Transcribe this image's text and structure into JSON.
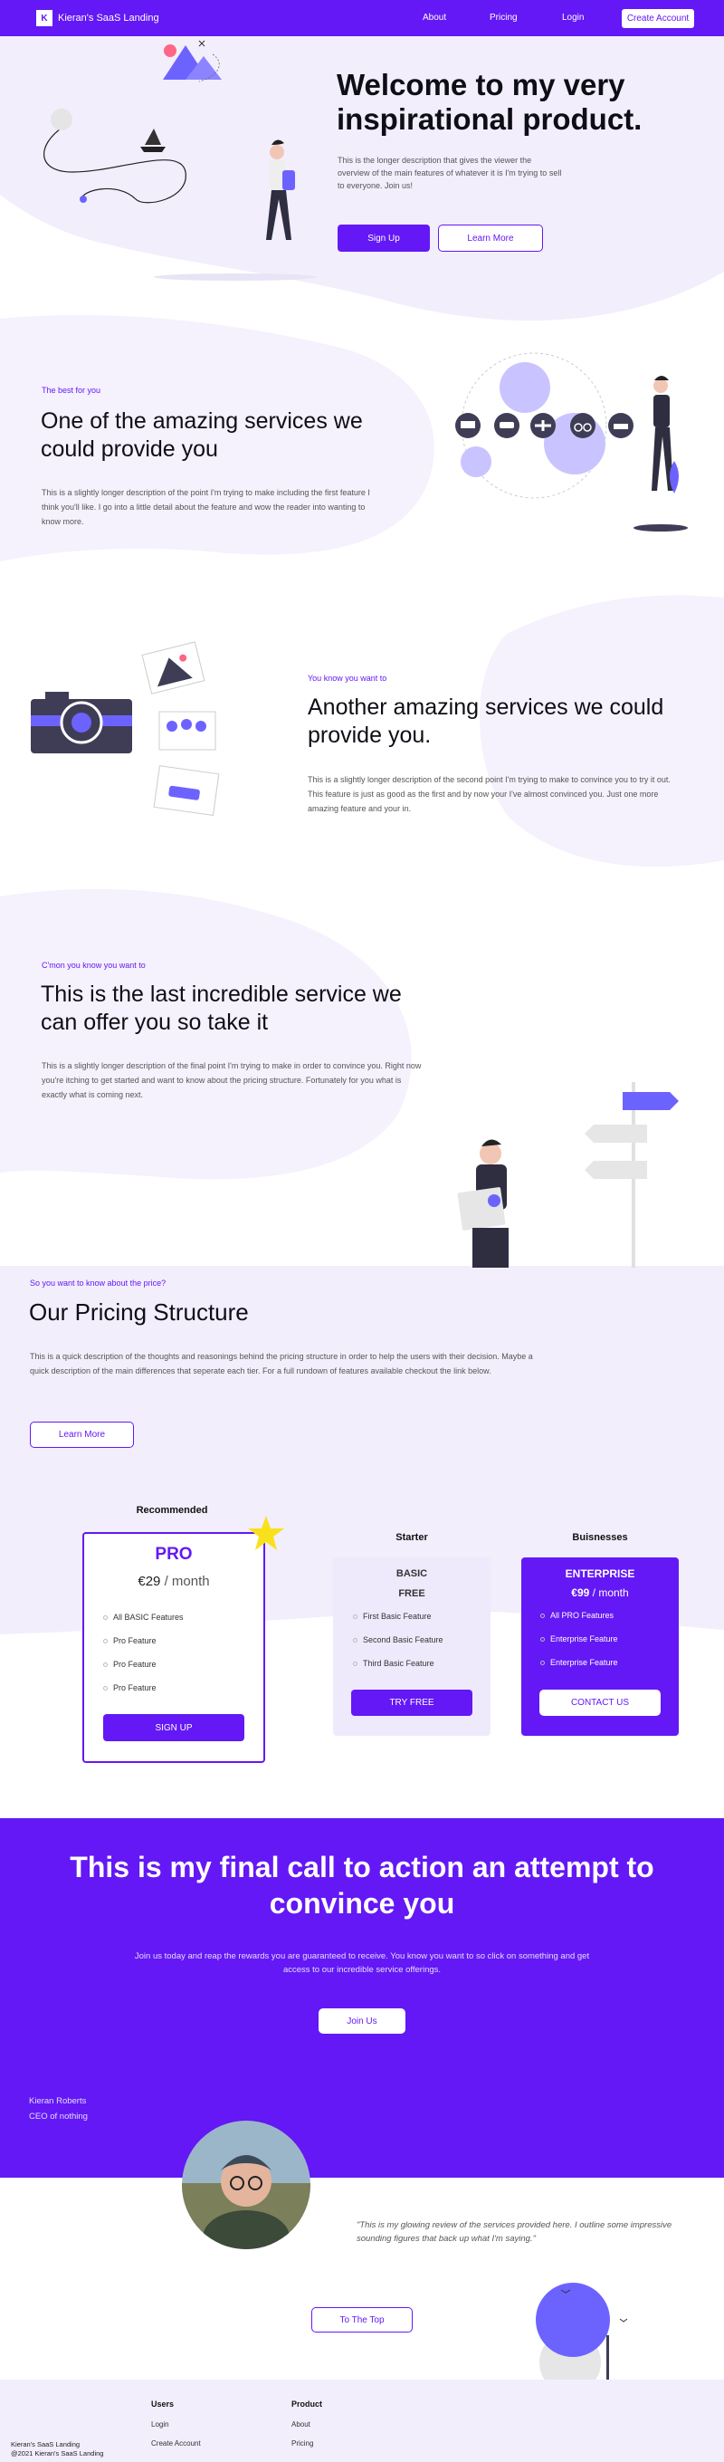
{
  "nav": {
    "brand": "Kieran's SaaS Landing",
    "links": [
      "About",
      "Pricing",
      "Login"
    ],
    "cta": "Create Account"
  },
  "hero": {
    "title": "Welcome to my very inspirational product.",
    "description": "This is the longer description that gives the viewer the overview of the main features of whatever it is I'm trying to sell to everyone. Join us!",
    "primary_button": "Sign Up",
    "secondary_button": "Learn More"
  },
  "feature1": {
    "eyebrow": "The best for you",
    "title": "One of the amazing services we could provide you",
    "description": "This is a slightly longer description of the point I'm trying to make including the first feature I think you'll like. I go into a little detail about the feature and wow the reader into wanting to know more."
  },
  "feature2": {
    "eyebrow": "You know you want to",
    "title": "Another amazing services we could provide you.",
    "description": "This is a slightly longer description of the second point I'm trying to make to convince you to try it out. This feature is just as good as the first and by now your I've almost convinced you. Just one more amazing feature and your in."
  },
  "feature3": {
    "eyebrow": "C'mon you know you want to",
    "title": "This is the last incredible service we can offer you so take it",
    "description": "This is a slightly longer description of the final point I'm trying to make in order to convince you. Right now you're itching to get started and want to know about the pricing structure. Fortunately for you what is exactly what is coming next."
  },
  "pricing": {
    "eyebrow": "So you want to know about the price?",
    "title": "Our Pricing Structure",
    "description": "This is a quick description of the thoughts and reasonings behind the pricing structure in order to help the users with their decision. Maybe a quick description of the main differences that seperate each tier. For a full rundown of features available checkout the link below.",
    "button": "Learn More",
    "plans": [
      {
        "heading": "Recommended",
        "name": "PRO",
        "price": "€29",
        "period": "/ month",
        "features": [
          "All BASIC Features",
          "Pro Feature",
          "Pro Feature",
          "Pro Feature"
        ],
        "button": "SIGN UP"
      },
      {
        "heading": "Starter",
        "name": "BASIC",
        "price": "FREE",
        "features": [
          "First Basic Feature",
          "Second Basic Feature",
          "Third Basic Feature"
        ],
        "button": "TRY FREE"
      },
      {
        "heading": "Buisnesses",
        "name": "ENTERPRISE",
        "price": "€99",
        "period": "/ month",
        "features": [
          "All PRO Features",
          "Enterprise Feature",
          "Enterprise Feature"
        ],
        "button": "CONTACT US"
      }
    ]
  },
  "cta": {
    "title": "This is my final call to action an attempt to convince you",
    "description": "Join us today and reap the rewards you are guaranteed to receive. You know you want to so click on something and get access to our incredible service offerings.",
    "button": "Join Us"
  },
  "testimonial": {
    "name": "Kieran Roberts",
    "role": "CEO of nothing",
    "quote": "\"This is my glowing review of the services provided here. I outline some impressive sounding figures that back up what I'm saying.\""
  },
  "to_top": "To The Top",
  "footer": {
    "brand": "Kieran's SaaS Landing",
    "copyright": "@2021 Kieran's SaaS Landing",
    "columns": [
      {
        "heading": "Users",
        "links": [
          "Login",
          "Create Account"
        ]
      },
      {
        "heading": "Product",
        "links": [
          "About",
          "Pricing"
        ]
      }
    ]
  },
  "colors": {
    "brand": "#6418f5",
    "accent_star": "#f8e11b",
    "blob": "#f2eefc"
  }
}
